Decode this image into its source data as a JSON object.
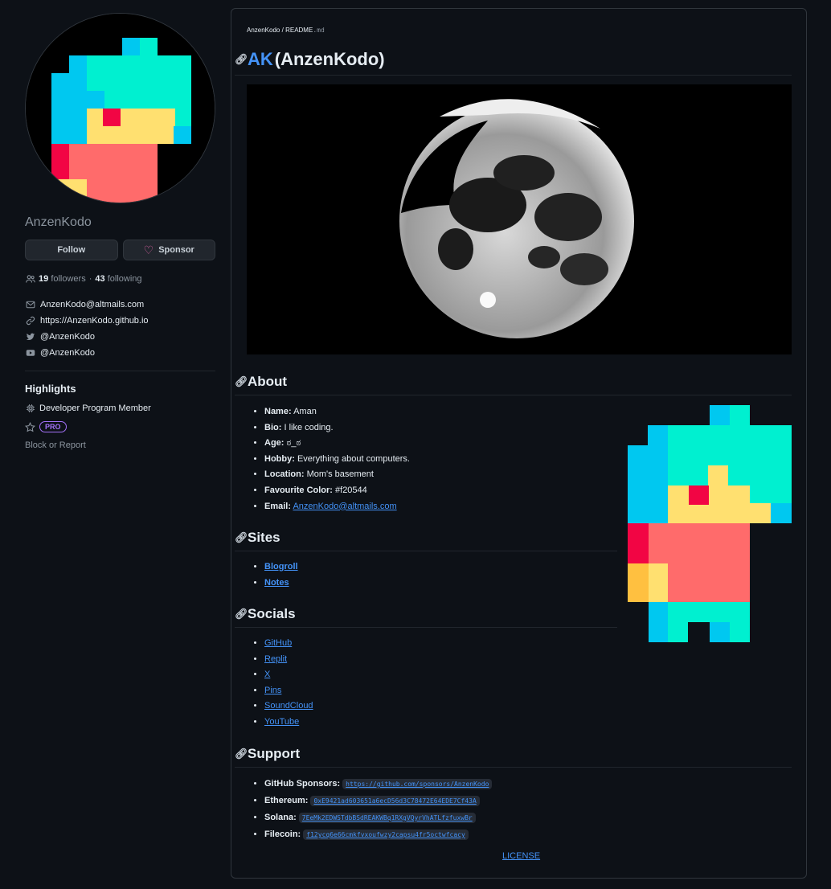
{
  "profile": {
    "username": "AnzenKodo",
    "follow_label": "Follow",
    "sponsor_label": "Sponsor",
    "followers_count": "19",
    "followers_label": "followers",
    "separator": "·",
    "following_count": "43",
    "following_label": "following",
    "email": "AnzenKodo@altmails.com",
    "website": "https://AnzenKodo.github.io",
    "twitter": "@AnzenKodo",
    "youtube": "@AnzenKodo",
    "highlights_title": "Highlights",
    "developer_program": "Developer Program Member",
    "pro_badge": "PRO",
    "block_report": "Block or Report"
  },
  "readme": {
    "breadcrumb_user": "AnzenKodo",
    "breadcrumb_sep": "/",
    "breadcrumb_file": "README",
    "breadcrumb_ext": ".md",
    "title_accent": "AK",
    "title_rest": "(AnzenKodo)",
    "about": {
      "heading": "About",
      "items": [
        {
          "label": "Name:",
          "value": "Aman"
        },
        {
          "label": "Bio:",
          "value": "I like coding."
        },
        {
          "label": "Age:",
          "value": "ಠ_ಠ"
        },
        {
          "label": "Hobby:",
          "value": "Everything about computers."
        },
        {
          "label": "Location:",
          "value": "Mom's basement"
        },
        {
          "label": "Favourite Color:",
          "value": "#f20544"
        },
        {
          "label": "Email:",
          "value": "AnzenKodo@altmails.com"
        }
      ]
    },
    "sites": {
      "heading": "Sites",
      "links": [
        "Blogroll",
        "Notes"
      ]
    },
    "socials": {
      "heading": "Socials",
      "links": [
        "GitHub",
        "Replit",
        "X",
        "Pins",
        "SoundCloud",
        "YouTube"
      ]
    },
    "support": {
      "heading": "Support",
      "items": [
        {
          "label": "GitHub Sponsors:",
          "value": "https://github.com/sponsors/AnzenKodo"
        },
        {
          "label": "Ethereum:",
          "value": "0xE9421ad603651a6ecD56d3C78472E64EDE7Cf43A"
        },
        {
          "label": "Solana:",
          "value": "7EeMk2EDWSTdbBSdREAKWBq1RXgVQyrVhATLfzfuxwBr"
        },
        {
          "label": "Filecoin:",
          "value": "f12ycq6e66cmkfvxoufwzy2capsu4fr5octwfcacy"
        }
      ]
    },
    "license": "LICENSE"
  },
  "colors": {
    "background": "#0d1117",
    "link": "#4493f8",
    "border": "#30363d",
    "sprite_cyan": "#00f0d0",
    "sprite_blue": "#00c8f0",
    "sprite_yellow": "#ffe070",
    "sprite_red": "#f20544",
    "sprite_pink": "#ff6b6b"
  }
}
